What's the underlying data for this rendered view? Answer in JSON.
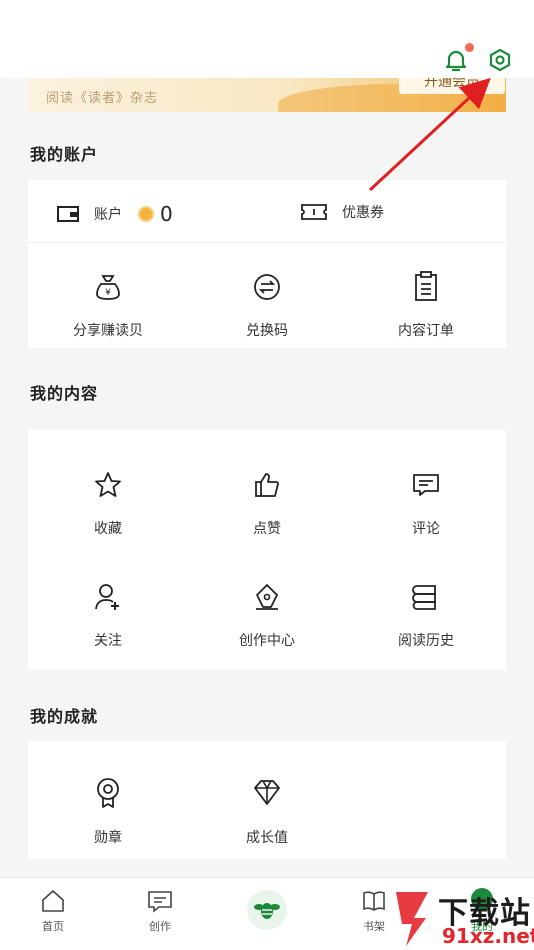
{
  "banner": {
    "text": "阅读《读者》杂志",
    "button": "开通会员"
  },
  "account_section": {
    "title": "我的账户",
    "account_label": "账户",
    "balance": "0",
    "coupon_label": "优惠券",
    "items": [
      "分享赚读贝",
      "兑换码",
      "内容订单"
    ]
  },
  "content_section": {
    "title": "我的内容",
    "items": [
      "收藏",
      "点赞",
      "评论",
      "关注",
      "创作中心",
      "阅读历史"
    ]
  },
  "achievement_section": {
    "title": "我的成就",
    "items": [
      "勋章",
      "成长值"
    ]
  },
  "bottom_nav": [
    "首页",
    "创作",
    "书架",
    "我的"
  ],
  "watermark": {
    "top": "下载站",
    "bottom": "91xz.net"
  },
  "colors": {
    "accent": "#1c8a3c",
    "notify_dot": "#f06b55",
    "arrow": "#e02020"
  }
}
